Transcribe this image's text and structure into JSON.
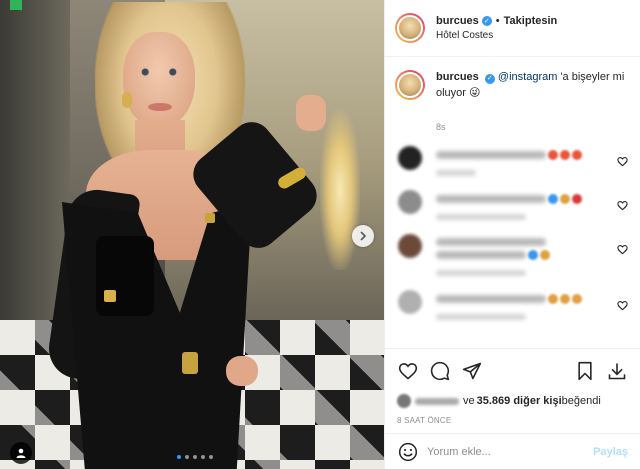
{
  "header": {
    "username": "burcues",
    "verified_mark": "✓",
    "separator": "•",
    "follow_status": "Takiptesin",
    "location": "Hôtel Costes"
  },
  "caption": {
    "username": "burcues",
    "verified_mark": "✓",
    "mention": "@instagram",
    "text": " 'a bişeyler mi oluyor 😜",
    "time": "8s"
  },
  "comments": [
    {
      "avatar_color": "#222222",
      "emojis": [
        "#e8553a",
        "#e8553a",
        "#e8553a"
      ],
      "lines": 1
    },
    {
      "avatar_color": "#8c8c8c",
      "emojis": [
        "#3897f0",
        "#e0a040",
        "#d83a3a"
      ],
      "lines": 1
    },
    {
      "avatar_color": "#6b4a3a",
      "emojis": [
        "#3897f0",
        "#e0a040"
      ],
      "lines": 2
    },
    {
      "avatar_color": "#b0b0b0",
      "emojis": [
        "#e0a040",
        "#e0a040",
        "#e0a040"
      ],
      "lines": 1
    }
  ],
  "likes": {
    "text_prefix": "ve ",
    "count": "35.869 diğer kişi",
    "suffix": " beğendi"
  },
  "time_ago": "8 SAAT ÖNCE",
  "add_comment": {
    "placeholder": "Yorum ekle...",
    "post_label": "Paylaş"
  },
  "colors": {
    "accent": "#3897f0",
    "text": "#262626",
    "muted": "#8e8e8e",
    "border": "#efefef"
  },
  "icons": [
    "heart-icon",
    "comment-icon",
    "share-icon",
    "bookmark-icon",
    "download-icon",
    "smile-icon",
    "user-tag-icon",
    "chevron-right-icon",
    "verified-icon"
  ]
}
